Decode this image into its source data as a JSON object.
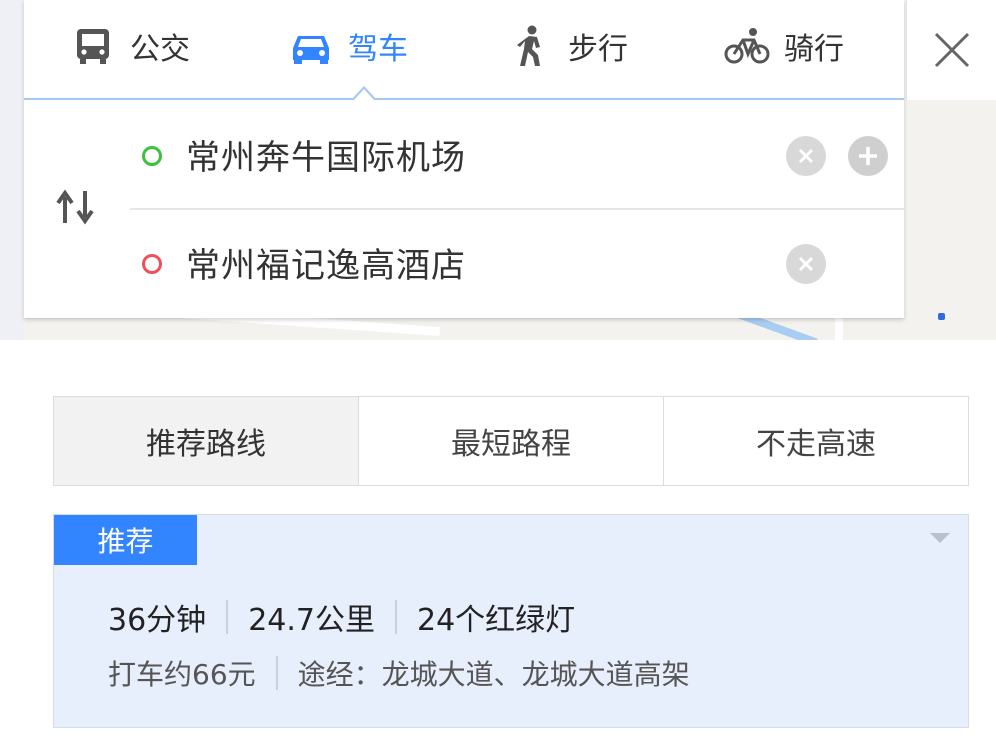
{
  "modes": [
    {
      "label": "公交",
      "icon": "bus-icon"
    },
    {
      "label": "驾车",
      "icon": "car-icon",
      "active": true
    },
    {
      "label": "步行",
      "icon": "walk-icon"
    },
    {
      "label": "骑行",
      "icon": "bike-icon"
    }
  ],
  "route": {
    "start": "常州奔牛国际机场",
    "end": "常州福记逸高酒店"
  },
  "route_options": [
    {
      "label": "推荐路线",
      "active": true
    },
    {
      "label": "最短路程"
    },
    {
      "label": "不走高速"
    }
  ],
  "result": {
    "badge": "推荐",
    "duration": "36分钟",
    "distance": "24.7公里",
    "lights": "24个红绿灯",
    "taxi": "打车约66元",
    "via": "途经：龙城大道、龙城大道高架"
  },
  "colors": {
    "accent": "#3385ff",
    "start_dot": "#3ac23a",
    "end_dot": "#f0505a",
    "result_bg": "#e7eefc"
  }
}
